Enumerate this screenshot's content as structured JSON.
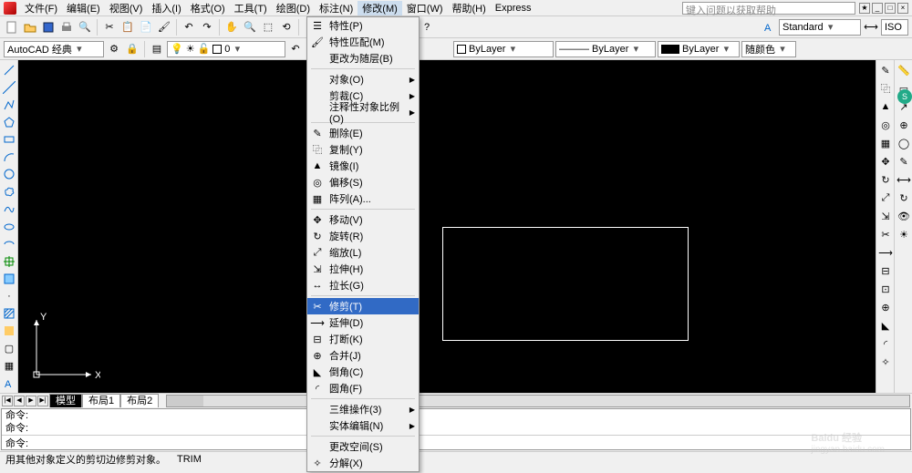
{
  "menubar": {
    "items": [
      "文件(F)",
      "编辑(E)",
      "视图(V)",
      "插入(I)",
      "格式(O)",
      "工具(T)",
      "绘图(D)",
      "标注(N)",
      "修改(M)",
      "窗口(W)",
      "帮助(H)",
      "Express"
    ],
    "open_index": 8,
    "search_placeholder": "键入问题以获取帮助"
  },
  "workspace_combo": "AutoCAD 经典",
  "layer_combo": "0",
  "props": {
    "color": "ByLayer",
    "ltype": "ByLayer",
    "lweight": "ByLayer",
    "pstyle": "随颜色",
    "stdstyle": "Standard",
    "iso": "ISO"
  },
  "ucs": {
    "x": "X",
    "y": "Y"
  },
  "tabs": {
    "nav": [
      "|◀",
      "◀",
      "▶",
      "▶|"
    ],
    "items": [
      "模型",
      "布局1",
      "布局2"
    ],
    "active": 0
  },
  "cmd": {
    "hist1": "命令:",
    "hist2": "命令:",
    "prompt": "命令:"
  },
  "status": {
    "hint": "用其他对象定义的剪切边修剪对象。",
    "mode": "TRIM"
  },
  "dropdown": {
    "items": [
      {
        "icon": "props",
        "label": "特性(P)",
        "sub": false
      },
      {
        "icon": "match",
        "label": "特性匹配(M)",
        "sub": false
      },
      {
        "icon": "",
        "label": "更改为随层(B)",
        "sub": false
      },
      {
        "sep": true
      },
      {
        "icon": "",
        "label": "对象(O)",
        "sub": true
      },
      {
        "icon": "",
        "label": "剪裁(C)",
        "sub": true
      },
      {
        "icon": "",
        "label": "注释性对象比例(O)",
        "sub": true
      },
      {
        "sep": true
      },
      {
        "icon": "erase",
        "label": "删除(E)",
        "sub": false
      },
      {
        "icon": "copy",
        "label": "复制(Y)",
        "sub": false
      },
      {
        "icon": "mirror",
        "label": "镜像(I)",
        "sub": false
      },
      {
        "icon": "offset",
        "label": "偏移(S)",
        "sub": false
      },
      {
        "icon": "array",
        "label": "阵列(A)...",
        "sub": false
      },
      {
        "sep": true
      },
      {
        "icon": "move",
        "label": "移动(V)",
        "sub": false
      },
      {
        "icon": "rotate",
        "label": "旋转(R)",
        "sub": false
      },
      {
        "icon": "scale",
        "label": "缩放(L)",
        "sub": false
      },
      {
        "icon": "stretch",
        "label": "拉伸(H)",
        "sub": false
      },
      {
        "icon": "lengthen",
        "label": "拉长(G)",
        "sub": false
      },
      {
        "sep": true
      },
      {
        "icon": "trim",
        "label": "修剪(T)",
        "sub": false,
        "hl": true
      },
      {
        "icon": "extend",
        "label": "延伸(D)",
        "sub": false
      },
      {
        "icon": "break",
        "label": "打断(K)",
        "sub": false
      },
      {
        "icon": "join",
        "label": "合并(J)",
        "sub": false
      },
      {
        "icon": "chamfer",
        "label": "倒角(C)",
        "sub": false
      },
      {
        "icon": "fillet",
        "label": "圆角(F)",
        "sub": false
      },
      {
        "sep": true
      },
      {
        "icon": "",
        "label": "三维操作(3)",
        "sub": true
      },
      {
        "icon": "",
        "label": "实体编辑(N)",
        "sub": true
      },
      {
        "sep": true
      },
      {
        "icon": "",
        "label": "更改空间(S)",
        "sub": false
      },
      {
        "icon": "explode",
        "label": "分解(X)",
        "sub": false
      }
    ]
  },
  "watermark": {
    "main": "Baidu 经验",
    "sub": "jingyan.baidu.com"
  }
}
